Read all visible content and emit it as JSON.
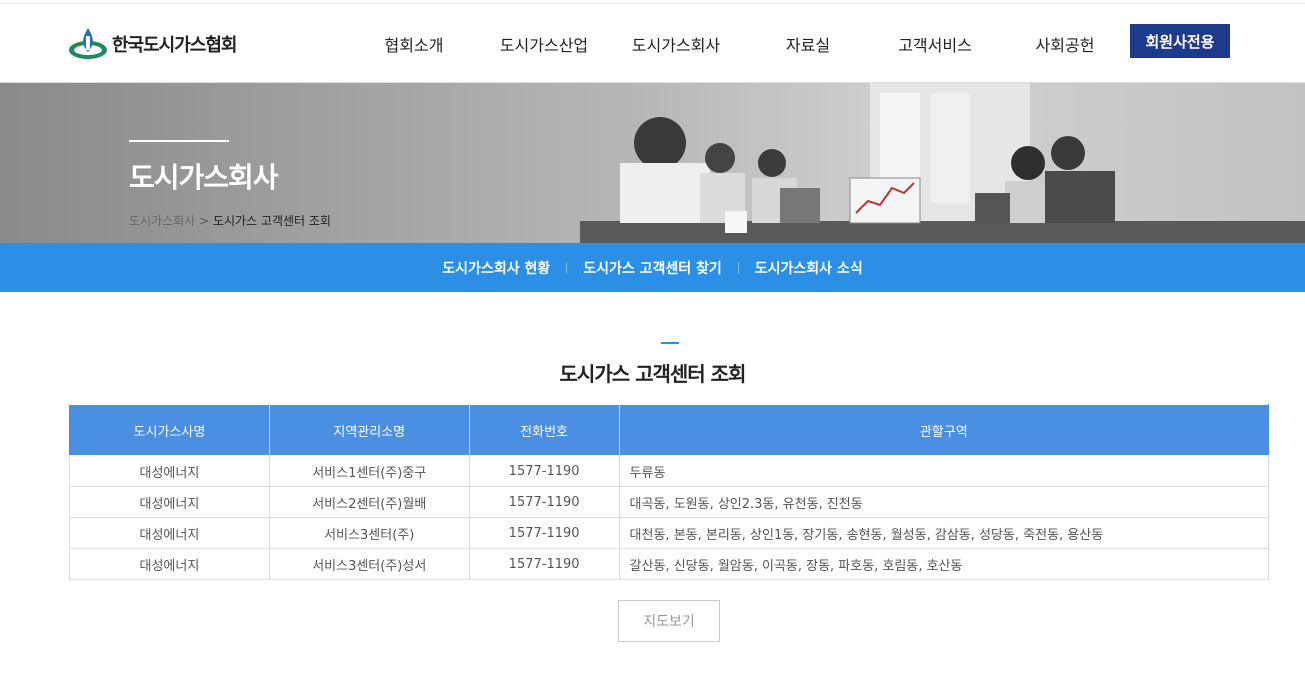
{
  "header": {
    "logo_text": "한국도시가스협회",
    "nav": [
      {
        "label": "협회소개"
      },
      {
        "label": "도시가스산업"
      },
      {
        "label": "도시가스회사"
      },
      {
        "label": "자료실"
      },
      {
        "label": "고객서비스"
      },
      {
        "label": "사회공헌"
      }
    ],
    "member_button": "회원사전용"
  },
  "hero": {
    "title": "도시가스회사",
    "breadcrumb_home": "도시가스회사",
    "breadcrumb_separator": " > ",
    "breadcrumb_current": "도시가스 고객센터 조회"
  },
  "subnav": [
    {
      "label": "도시가스회사 현황"
    },
    {
      "label": "도시가스 고객센터 찾기"
    },
    {
      "label": "도시가스회사 소식"
    }
  ],
  "section": {
    "title": "도시가스 고객센터 조회"
  },
  "table": {
    "headers": [
      "도시가스사명",
      "지역관리소명",
      "전화번호",
      "관할구역"
    ],
    "rows": [
      [
        "대성에너지",
        "서비스1센터(주)중구",
        "1577-1190",
        "두류동"
      ],
      [
        "대성에너지",
        "서비스2센터(주)월배",
        "1577-1190",
        "대곡동, 도원동, 상인2.3동, 유천동, 진천동"
      ],
      [
        "대성에너지",
        "서비스3센터(주)",
        "1577-1190",
        "대천동, 본동, 본리동, 상인1동, 장기동, 송현동, 월성동, 감삼동, 성당동, 죽전동, 용산동"
      ],
      [
        "대성에너지",
        "서비스3센터(주)성서",
        "1577-1190",
        "갈산동, 신당동, 월암동, 이곡동, 장동, 파호동, 호림동, 호산동"
      ]
    ]
  },
  "map_button": "지도보기",
  "colors": {
    "brand_navy": "#1e3a8a",
    "subnav_blue": "#2b8fe6",
    "table_header_blue": "#4a8fe2"
  }
}
